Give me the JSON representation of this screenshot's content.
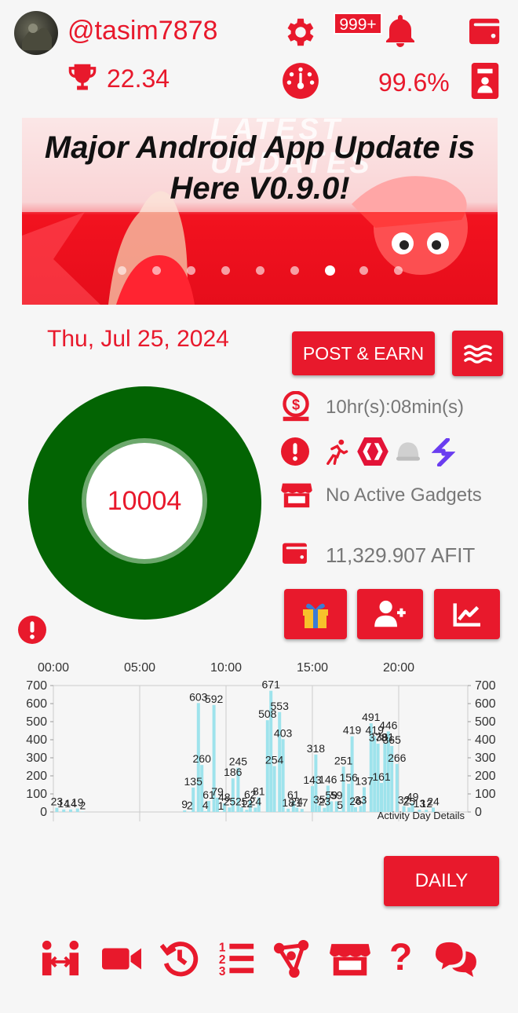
{
  "header": {
    "username": "@tasim7878",
    "notification_badge": "999+",
    "trophy_value": "22.34",
    "percent_value": "99.6%"
  },
  "banner": {
    "watermark": "LATEST UPDATES",
    "title": "Major Android App Update is Here V0.9.0!",
    "slide_count": 9,
    "active_slide": 7
  },
  "main": {
    "date": "Thu, Jul 25, 2024",
    "post_earn_label": "POST & EARN",
    "ring_value": "10004",
    "timer_text": "10hr(s):08min(s)",
    "gadgets_text": "No Active Gadgets",
    "balance_text": "11,329.907 AFIT"
  },
  "chart_data": {
    "type": "bar",
    "top_axis_labels": [
      "00:00",
      "05:00",
      "10:00",
      "15:00",
      "20:00"
    ],
    "y_ticks": [
      "700",
      "600",
      "500",
      "400",
      "300",
      "200",
      "100",
      "0"
    ],
    "ylim": [
      0,
      700
    ],
    "xlim_hours": [
      0,
      24
    ],
    "annotation": "Activity Day Details",
    "bar_color": "#9ee3ec",
    "bars": [
      {
        "x": 0.2,
        "y": 23,
        "label": "23"
      },
      {
        "x": 0.6,
        "y": 14,
        "label": "14"
      },
      {
        "x": 1.0,
        "y": 14,
        "label": "14"
      },
      {
        "x": 1.4,
        "y": 19,
        "label": "19"
      },
      {
        "x": 1.7,
        "y": 2,
        "label": "2"
      },
      {
        "x": 7.6,
        "y": 9,
        "label": "9"
      },
      {
        "x": 7.9,
        "y": 2,
        "label": "2"
      },
      {
        "x": 8.1,
        "y": 135,
        "label": "135"
      },
      {
        "x": 8.4,
        "y": 603,
        "label": "603"
      },
      {
        "x": 8.6,
        "y": 260,
        "label": "260"
      },
      {
        "x": 8.8,
        "y": 4,
        "label": "4"
      },
      {
        "x": 9.0,
        "y": 61,
        "label": "61"
      },
      {
        "x": 9.3,
        "y": 592,
        "label": "592"
      },
      {
        "x": 9.5,
        "y": 79,
        "label": "79"
      },
      {
        "x": 9.7,
        "y": 1,
        "label": "1"
      },
      {
        "x": 9.9,
        "y": 48,
        "label": "48"
      },
      {
        "x": 10.2,
        "y": 25,
        "label": "25"
      },
      {
        "x": 10.4,
        "y": 186,
        "label": "186"
      },
      {
        "x": 10.7,
        "y": 245,
        "label": "245"
      },
      {
        "x": 10.9,
        "y": 25,
        "label": "25"
      },
      {
        "x": 11.2,
        "y": 12,
        "label": "12"
      },
      {
        "x": 11.4,
        "y": 62,
        "label": "62"
      },
      {
        "x": 11.7,
        "y": 24,
        "label": "24"
      },
      {
        "x": 11.9,
        "y": 81,
        "label": "81"
      },
      {
        "x": 12.4,
        "y": 508,
        "label": "508"
      },
      {
        "x": 12.6,
        "y": 671,
        "label": "671"
      },
      {
        "x": 12.8,
        "y": 254,
        "label": "254"
      },
      {
        "x": 13.1,
        "y": 553,
        "label": "553"
      },
      {
        "x": 13.3,
        "y": 403,
        "label": "403"
      },
      {
        "x": 13.6,
        "y": 18,
        "label": "18"
      },
      {
        "x": 13.9,
        "y": 61,
        "label": "61"
      },
      {
        "x": 14.1,
        "y": 24,
        "label": "24"
      },
      {
        "x": 14.4,
        "y": 17,
        "label": "17"
      },
      {
        "x": 15.0,
        "y": 143,
        "label": "143"
      },
      {
        "x": 15.2,
        "y": 318,
        "label": "318"
      },
      {
        "x": 15.4,
        "y": 35,
        "label": "35"
      },
      {
        "x": 15.7,
        "y": 23,
        "label": "23"
      },
      {
        "x": 15.9,
        "y": 146,
        "label": "146"
      },
      {
        "x": 16.1,
        "y": 59,
        "label": "59"
      },
      {
        "x": 16.4,
        "y": 59,
        "label": "59"
      },
      {
        "x": 16.6,
        "y": 5,
        "label": "5"
      },
      {
        "x": 16.8,
        "y": 251,
        "label": "251"
      },
      {
        "x": 17.1,
        "y": 156,
        "label": "156"
      },
      {
        "x": 17.3,
        "y": 419,
        "label": "419"
      },
      {
        "x": 17.5,
        "y": 26,
        "label": "26"
      },
      {
        "x": 17.8,
        "y": 33,
        "label": "33"
      },
      {
        "x": 18.0,
        "y": 137,
        "label": "137"
      },
      {
        "x": 18.4,
        "y": 491,
        "label": "491"
      },
      {
        "x": 18.6,
        "y": 419,
        "label": "419"
      },
      {
        "x": 18.8,
        "y": 378,
        "label": "378"
      },
      {
        "x": 19.0,
        "y": 161,
        "label": "161"
      },
      {
        "x": 19.2,
        "y": 381,
        "label": "381"
      },
      {
        "x": 19.4,
        "y": 446,
        "label": "446"
      },
      {
        "x": 19.6,
        "y": 365,
        "label": "365"
      },
      {
        "x": 19.9,
        "y": 266,
        "label": "266"
      },
      {
        "x": 20.3,
        "y": 32,
        "label": "32"
      },
      {
        "x": 20.6,
        "y": 25,
        "label": "25"
      },
      {
        "x": 20.8,
        "y": 49,
        "label": "49"
      },
      {
        "x": 21.2,
        "y": 13,
        "label": "13"
      },
      {
        "x": 21.6,
        "y": 12,
        "label": "12"
      },
      {
        "x": 22.0,
        "y": 24,
        "label": "24"
      }
    ]
  },
  "footer": {
    "daily_label": "DAILY",
    "bottom_nav": [
      "transfer-icon",
      "video-icon",
      "history-icon",
      "list-icon",
      "share-icon",
      "store-icon",
      "help-icon",
      "chat-icon"
    ]
  }
}
